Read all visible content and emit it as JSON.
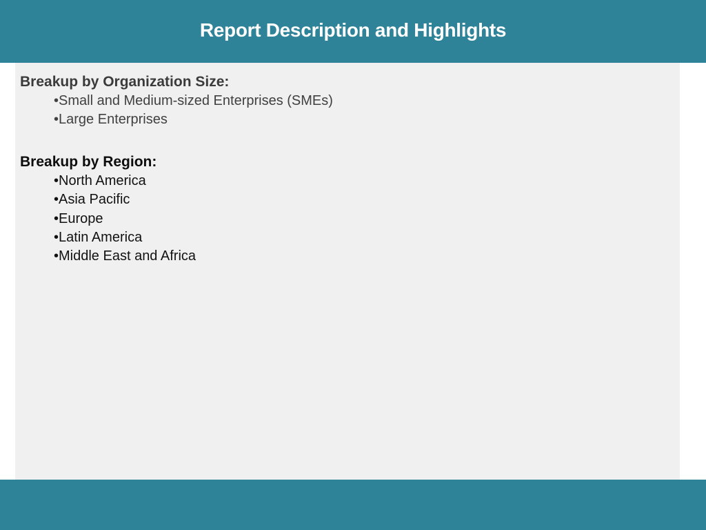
{
  "header": {
    "title": "Report Description and Highlights"
  },
  "sections": [
    {
      "heading": "Breakup by Organization Size:",
      "items": [
        "Small and Medium-sized Enterprises (SMEs)",
        "Large Enterprises"
      ]
    },
    {
      "heading": "Breakup by Region:",
      "items": [
        "North America",
        "Asia Pacific",
        "Europe",
        "Latin America",
        "Middle East and Africa"
      ]
    }
  ],
  "bullet_glyph": "•",
  "colors": {
    "accent_bar": "#2f8399",
    "panel_background": "#f0f0f0",
    "title_text": "#ffffff"
  }
}
